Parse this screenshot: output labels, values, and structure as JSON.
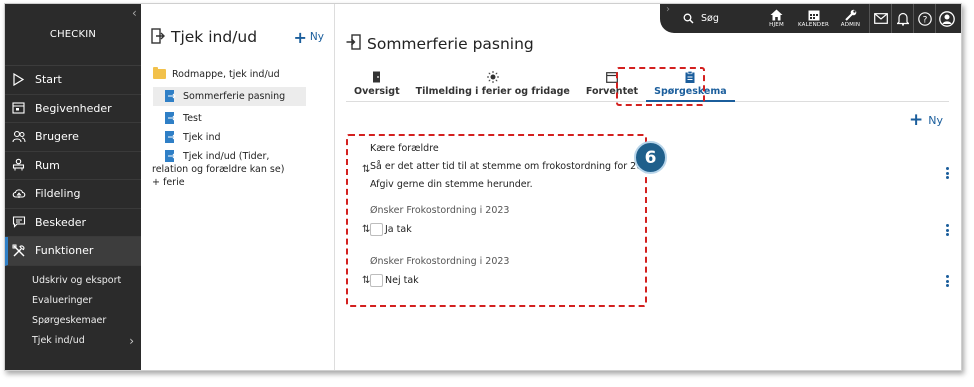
{
  "app": {
    "brand": "CHECKIN"
  },
  "colors": {
    "accent": "#1b5e9c",
    "highlight": "#d3201f",
    "nav_bg": "#2b2b2b"
  },
  "sidebar": {
    "items": [
      {
        "label": "Start",
        "icon": "play-icon"
      },
      {
        "label": "Begivenheder",
        "icon": "calendar-icon"
      },
      {
        "label": "Brugere",
        "icon": "users-icon"
      },
      {
        "label": "Rum",
        "icon": "room-icon"
      },
      {
        "label": "Fildeling",
        "icon": "cloud-icon"
      },
      {
        "label": "Beskeder",
        "icon": "chat-icon"
      },
      {
        "label": "Funktioner",
        "icon": "tools-icon"
      }
    ],
    "subitems": [
      "Udskriv og eksport",
      "Evalueringer",
      "Spørgeskemaer",
      "Tjek ind/ud"
    ]
  },
  "topbar": {
    "search": "Søg",
    "buttons": [
      "HJEM",
      "KALENDER",
      "ADMIN"
    ]
  },
  "mid": {
    "title": "Tjek ind/ud",
    "new": "Ny",
    "folder": "Rodmappe, tjek ind/ud",
    "items": [
      "Sommerferie pasning",
      "Test",
      "Tjek ind",
      "Tjek ind/ud (Tider, relation og forældre kan se) + ferie"
    ]
  },
  "main": {
    "title": "Sommerferie pasning",
    "tabs": [
      "Oversigt",
      "Tilmelding i ferier og fridage",
      "Forventet",
      "Spørgeskema"
    ],
    "new": "Ny",
    "intro": [
      "Kære forældre",
      "Så er det atter tid til at stemme om frokostordning for 2023",
      "Afgiv gerne din stemme herunder."
    ],
    "questions": [
      {
        "label": "Ønsker Frokostordning i 2023",
        "option": "Ja tak"
      },
      {
        "label": "Ønsker Frokostordning i 2023",
        "option": "Nej tak"
      }
    ],
    "badge": "6"
  }
}
